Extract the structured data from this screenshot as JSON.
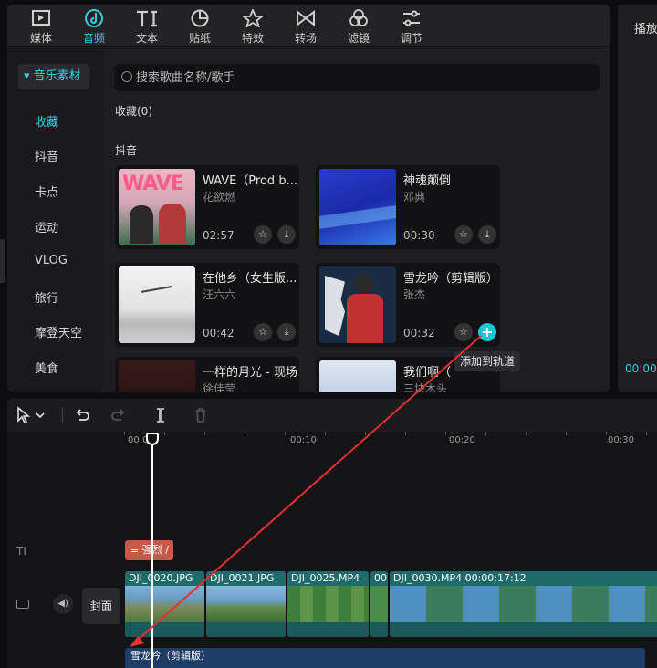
{
  "toolbar": {
    "tabs": [
      {
        "label": "媒体",
        "icon": "media-icon"
      },
      {
        "label": "音频",
        "icon": "audio-icon"
      },
      {
        "label": "文本",
        "icon": "text-icon"
      },
      {
        "label": "贴纸",
        "icon": "sticker-icon"
      },
      {
        "label": "特效",
        "icon": "effects-icon"
      },
      {
        "label": "转场",
        "icon": "transition-icon"
      },
      {
        "label": "滤镜",
        "icon": "filter-icon"
      },
      {
        "label": "调节",
        "icon": "adjust-icon"
      }
    ],
    "active_tab": "音频"
  },
  "sidebar": {
    "header": "音乐素材",
    "items": [
      "收藏",
      "抖音",
      "卡点",
      "运动",
      "VLOG",
      "旅行",
      "摩登天空",
      "美食"
    ],
    "active_item": "收藏"
  },
  "search": {
    "placeholder": "搜索歌曲名称/歌手"
  },
  "sections": {
    "favorites": "收藏(0)",
    "douyin": "抖音"
  },
  "songs": [
    {
      "title": "WAVE（Prod b...",
      "artist": "花欲燃",
      "duration": "02:57",
      "thumb_text": "WAVE"
    },
    {
      "title": "神魂颠倒",
      "artist": "邓典",
      "duration": "00:30"
    },
    {
      "title": "在他乡（女生版...",
      "artist": "汪六六",
      "duration": "00:42"
    },
    {
      "title": "雪龙吟（剪辑版）",
      "artist": "张杰",
      "duration": "00:32"
    },
    {
      "title": "一样的月光 - 现场",
      "artist": "徐佳莹",
      "duration": ""
    },
    {
      "title": "我们啊（",
      "artist": "三块木头",
      "duration": ""
    }
  ],
  "tooltip": "添加到轨道",
  "preview": {
    "title": "播放",
    "time": "00:00"
  },
  "timeline": {
    "ruler": [
      "00:00",
      "00:10",
      "00:20",
      "00:30"
    ],
    "text_clip": "强烈 /",
    "cover_label": "封面",
    "video_clips": [
      {
        "name": "DJI_0020.JPG"
      },
      {
        "name": "DJI_0021.JPG"
      },
      {
        "name": "DJI_0025.MP4"
      },
      {
        "name": "00:"
      },
      {
        "name": "DJI_0030.MP4  00:00:17:12"
      }
    ],
    "audio_clip": "雪龙吟（剪辑版）"
  },
  "colors": {
    "accent": "#2fd0e0",
    "audio_track": "#1d3c66",
    "video_track": "#1f6a6a",
    "text_clip": "#c8584a"
  }
}
